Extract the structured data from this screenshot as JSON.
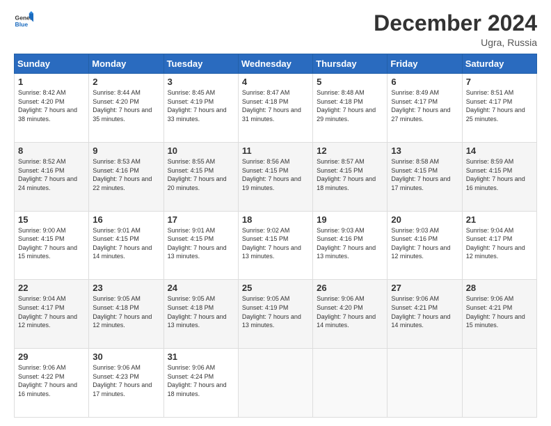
{
  "header": {
    "logo_general": "General",
    "logo_blue": "Blue",
    "month_title": "December 2024",
    "location": "Ugra, Russia"
  },
  "weekdays": [
    "Sunday",
    "Monday",
    "Tuesday",
    "Wednesday",
    "Thursday",
    "Friday",
    "Saturday"
  ],
  "weeks": [
    [
      {
        "day": "1",
        "sunrise": "Sunrise: 8:42 AM",
        "sunset": "Sunset: 4:20 PM",
        "daylight": "Daylight: 7 hours and 38 minutes."
      },
      {
        "day": "2",
        "sunrise": "Sunrise: 8:44 AM",
        "sunset": "Sunset: 4:20 PM",
        "daylight": "Daylight: 7 hours and 35 minutes."
      },
      {
        "day": "3",
        "sunrise": "Sunrise: 8:45 AM",
        "sunset": "Sunset: 4:19 PM",
        "daylight": "Daylight: 7 hours and 33 minutes."
      },
      {
        "day": "4",
        "sunrise": "Sunrise: 8:47 AM",
        "sunset": "Sunset: 4:18 PM",
        "daylight": "Daylight: 7 hours and 31 minutes."
      },
      {
        "day": "5",
        "sunrise": "Sunrise: 8:48 AM",
        "sunset": "Sunset: 4:18 PM",
        "daylight": "Daylight: 7 hours and 29 minutes."
      },
      {
        "day": "6",
        "sunrise": "Sunrise: 8:49 AM",
        "sunset": "Sunset: 4:17 PM",
        "daylight": "Daylight: 7 hours and 27 minutes."
      },
      {
        "day": "7",
        "sunrise": "Sunrise: 8:51 AM",
        "sunset": "Sunset: 4:17 PM",
        "daylight": "Daylight: 7 hours and 25 minutes."
      }
    ],
    [
      {
        "day": "8",
        "sunrise": "Sunrise: 8:52 AM",
        "sunset": "Sunset: 4:16 PM",
        "daylight": "Daylight: 7 hours and 24 minutes."
      },
      {
        "day": "9",
        "sunrise": "Sunrise: 8:53 AM",
        "sunset": "Sunset: 4:16 PM",
        "daylight": "Daylight: 7 hours and 22 minutes."
      },
      {
        "day": "10",
        "sunrise": "Sunrise: 8:55 AM",
        "sunset": "Sunset: 4:15 PM",
        "daylight": "Daylight: 7 hours and 20 minutes."
      },
      {
        "day": "11",
        "sunrise": "Sunrise: 8:56 AM",
        "sunset": "Sunset: 4:15 PM",
        "daylight": "Daylight: 7 hours and 19 minutes."
      },
      {
        "day": "12",
        "sunrise": "Sunrise: 8:57 AM",
        "sunset": "Sunset: 4:15 PM",
        "daylight": "Daylight: 7 hours and 18 minutes."
      },
      {
        "day": "13",
        "sunrise": "Sunrise: 8:58 AM",
        "sunset": "Sunset: 4:15 PM",
        "daylight": "Daylight: 7 hours and 17 minutes."
      },
      {
        "day": "14",
        "sunrise": "Sunrise: 8:59 AM",
        "sunset": "Sunset: 4:15 PM",
        "daylight": "Daylight: 7 hours and 16 minutes."
      }
    ],
    [
      {
        "day": "15",
        "sunrise": "Sunrise: 9:00 AM",
        "sunset": "Sunset: 4:15 PM",
        "daylight": "Daylight: 7 hours and 15 minutes."
      },
      {
        "day": "16",
        "sunrise": "Sunrise: 9:01 AM",
        "sunset": "Sunset: 4:15 PM",
        "daylight": "Daylight: 7 hours and 14 minutes."
      },
      {
        "day": "17",
        "sunrise": "Sunrise: 9:01 AM",
        "sunset": "Sunset: 4:15 PM",
        "daylight": "Daylight: 7 hours and 13 minutes."
      },
      {
        "day": "18",
        "sunrise": "Sunrise: 9:02 AM",
        "sunset": "Sunset: 4:15 PM",
        "daylight": "Daylight: 7 hours and 13 minutes."
      },
      {
        "day": "19",
        "sunrise": "Sunrise: 9:03 AM",
        "sunset": "Sunset: 4:16 PM",
        "daylight": "Daylight: 7 hours and 13 minutes."
      },
      {
        "day": "20",
        "sunrise": "Sunrise: 9:03 AM",
        "sunset": "Sunset: 4:16 PM",
        "daylight": "Daylight: 7 hours and 12 minutes."
      },
      {
        "day": "21",
        "sunrise": "Sunrise: 9:04 AM",
        "sunset": "Sunset: 4:17 PM",
        "daylight": "Daylight: 7 hours and 12 minutes."
      }
    ],
    [
      {
        "day": "22",
        "sunrise": "Sunrise: 9:04 AM",
        "sunset": "Sunset: 4:17 PM",
        "daylight": "Daylight: 7 hours and 12 minutes."
      },
      {
        "day": "23",
        "sunrise": "Sunrise: 9:05 AM",
        "sunset": "Sunset: 4:18 PM",
        "daylight": "Daylight: 7 hours and 12 minutes."
      },
      {
        "day": "24",
        "sunrise": "Sunrise: 9:05 AM",
        "sunset": "Sunset: 4:18 PM",
        "daylight": "Daylight: 7 hours and 13 minutes."
      },
      {
        "day": "25",
        "sunrise": "Sunrise: 9:05 AM",
        "sunset": "Sunset: 4:19 PM",
        "daylight": "Daylight: 7 hours and 13 minutes."
      },
      {
        "day": "26",
        "sunrise": "Sunrise: 9:06 AM",
        "sunset": "Sunset: 4:20 PM",
        "daylight": "Daylight: 7 hours and 14 minutes."
      },
      {
        "day": "27",
        "sunrise": "Sunrise: 9:06 AM",
        "sunset": "Sunset: 4:21 PM",
        "daylight": "Daylight: 7 hours and 14 minutes."
      },
      {
        "day": "28",
        "sunrise": "Sunrise: 9:06 AM",
        "sunset": "Sunset: 4:21 PM",
        "daylight": "Daylight: 7 hours and 15 minutes."
      }
    ],
    [
      {
        "day": "29",
        "sunrise": "Sunrise: 9:06 AM",
        "sunset": "Sunset: 4:22 PM",
        "daylight": "Daylight: 7 hours and 16 minutes."
      },
      {
        "day": "30",
        "sunrise": "Sunrise: 9:06 AM",
        "sunset": "Sunset: 4:23 PM",
        "daylight": "Daylight: 7 hours and 17 minutes."
      },
      {
        "day": "31",
        "sunrise": "Sunrise: 9:06 AM",
        "sunset": "Sunset: 4:24 PM",
        "daylight": "Daylight: 7 hours and 18 minutes."
      },
      null,
      null,
      null,
      null
    ]
  ]
}
